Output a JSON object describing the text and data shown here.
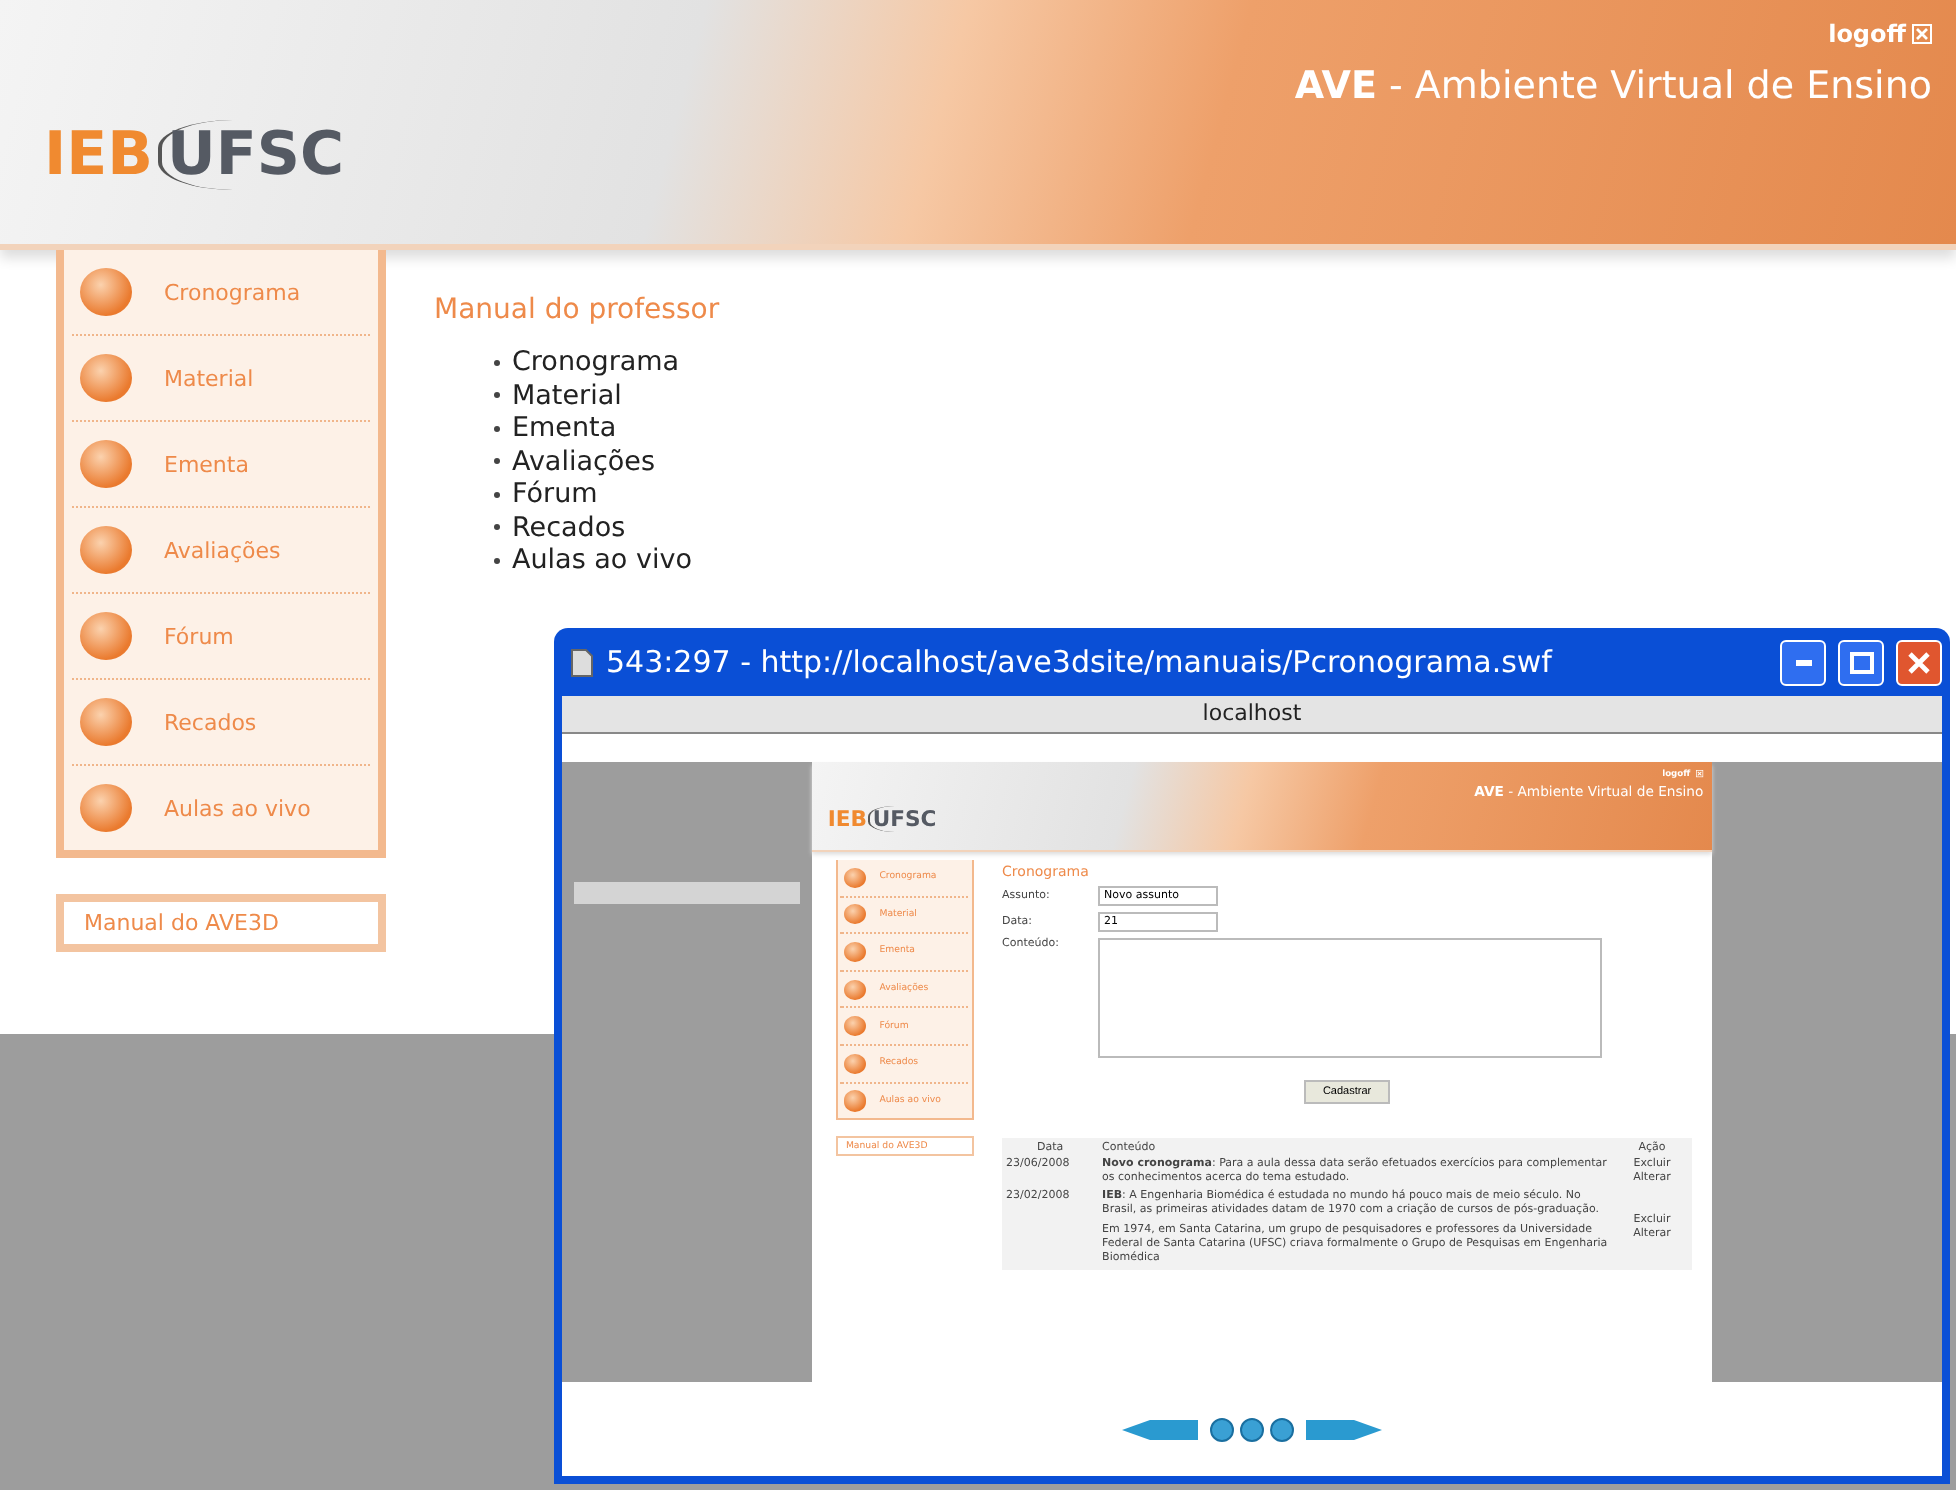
{
  "header": {
    "logo_left": "IEB",
    "logo_right": "UFSC",
    "logoff": "logoff",
    "title_bold": "AVE",
    "title_rest": "- Ambiente Virtual de Ensino"
  },
  "sidebar": {
    "items": [
      "Cronograma",
      "Material",
      "Ementa",
      "Avaliações",
      "Fórum",
      "Recados",
      "Aulas ao vivo"
    ],
    "manual": "Manual do AVE3D"
  },
  "content": {
    "heading": "Manual do professor",
    "links": [
      "Cronograma",
      "Material",
      "Ementa",
      "Avaliações",
      "Fórum",
      "Recados",
      "Aulas ao vivo"
    ]
  },
  "popup": {
    "title": "543:297 - http://localhost/ave3dsite/manuais/Pcronograma.swf",
    "host": "localhost",
    "page": {
      "logo_left": "IEB",
      "logo_right": "UFSC",
      "logoff": "logoff",
      "title_bold": "AVE",
      "title_rest": "- Ambiente Virtual de Ensino",
      "heading": "Cronograma",
      "menu": [
        "Cronograma",
        "Material",
        "Ementa",
        "Avaliações",
        "Fórum",
        "Recados",
        "Aulas ao vivo"
      ],
      "manual": "Manual do AVE3D",
      "fields": [
        {
          "label": "Assunto:",
          "value": "Novo assunto"
        },
        {
          "label": "Data:",
          "value": "21"
        }
      ],
      "content_label": "Conteúdo:",
      "submit": "Cadastrar",
      "columns": [
        "Data",
        "Conteúdo",
        "Ação"
      ],
      "rows": [
        {
          "date": "23/06/2008",
          "paragraphs": [
            "**Novo cronograma**: Para a aula dessa data serão efetuados exercícios para complementar os conhecimentos acerca do tema estudado."
          ],
          "actions": [
            "Excluir",
            "Alterar"
          ]
        },
        {
          "date": "23/02/2008",
          "paragraphs": [
            "**IEB**: A Engenharia Biomédica é estudada no mundo há pouco mais de meio século. No Brasil, as primeiras atividades datam de 1970 com a criação de cursos de pós-graduação.",
            "Em 1974, em Santa Catarina, um grupo de pesquisadores e professores da Universidade Federal de Santa Catarina (UFSC) criava formalmente o Grupo de Pesquisas em Engenharia Biomédica"
          ],
          "actions": [
            "Excluir",
            "Alterar"
          ]
        }
      ]
    }
  }
}
